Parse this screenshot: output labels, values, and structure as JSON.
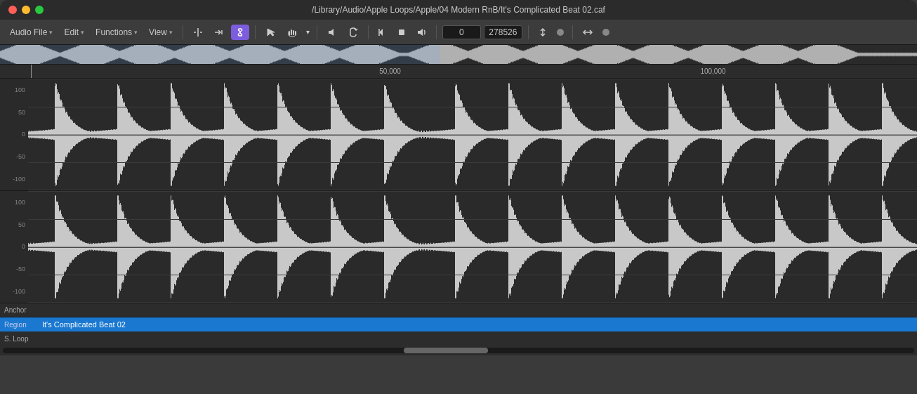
{
  "titlebar": {
    "title": "/Library/Audio/Apple Loops/Apple/04 Modern RnB/It's Complicated Beat 02.caf"
  },
  "toolbar": {
    "audio_file_label": "Audio File",
    "edit_label": "Edit",
    "functions_label": "Functions",
    "view_label": "View",
    "position_value": "0",
    "length_value": "278526",
    "icons": {
      "cursor_icon": "⟨|⟩",
      "trim_icon": "⇥",
      "link_icon": "🔗",
      "arrow_icon": "↖",
      "hand_icon": "✋",
      "speaker_icon": "🔈",
      "loop_icon": "↻",
      "prev_icon": "◀",
      "stop_icon": "⬛",
      "play_icon": "🔊",
      "swap_icon": "⇕",
      "expand_icon": "⇔"
    }
  },
  "timeline": {
    "markers": [
      {
        "label": "50,000",
        "position_pct": 38
      },
      {
        "label": "100,000",
        "position_pct": 73
      }
    ]
  },
  "waveform": {
    "channels": [
      {
        "id": "ch1",
        "labels": [
          "100",
          "50",
          "0",
          "-50",
          "-100"
        ]
      },
      {
        "id": "ch2",
        "labels": [
          "100",
          "50",
          "0",
          "-50",
          "-100"
        ]
      }
    ]
  },
  "bottom_rows": [
    {
      "id": "anchor",
      "label": "Anchor",
      "value": "",
      "style": "anchor"
    },
    {
      "id": "region",
      "label": "Region",
      "value": "It's Complicated Beat 02",
      "style": "region"
    },
    {
      "id": "sloop",
      "label": "S. Loop",
      "value": "",
      "style": "sloop"
    }
  ]
}
